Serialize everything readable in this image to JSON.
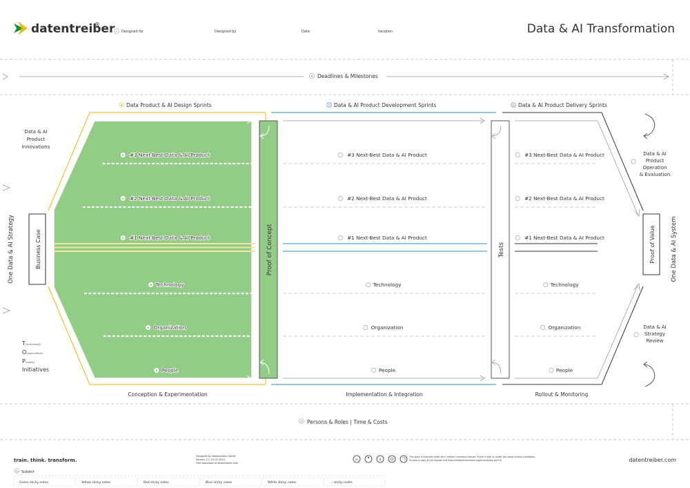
{
  "header": {
    "brand": "datentreiber",
    "brand_mark": "®",
    "title": "Data & AI Transformation",
    "fields": [
      {
        "num": "1",
        "label": "Designed for"
      },
      {
        "num": "",
        "label": "Designed by"
      },
      {
        "num": "",
        "label": "Date"
      },
      {
        "num": "",
        "label": "Iteration"
      }
    ]
  },
  "top_band": {
    "num": "2",
    "label": "Deadlines & Milestones"
  },
  "phases": [
    {
      "num": "4",
      "label": "Data Product & AI Design Sprints",
      "bottom": "Conception & Experimentation",
      "color": "#e8b400"
    },
    {
      "num": "7",
      "label": "Data & AI Product Development Sprints",
      "bottom": "Implementation & Integration",
      "color": "#1f8ec4"
    },
    {
      "num": "9",
      "label": "Data & AI Product Delivery Sprints",
      "bottom": "Rollout & Monitoring",
      "color": "#333333"
    }
  ],
  "left_side": {
    "innovations": [
      "Data & AI",
      "Product",
      "Innovations"
    ],
    "strategy": "One Data & AI Strategy",
    "business_case": "Business Case",
    "tdp": [
      {
        "cap": "T",
        "small": "(echnology)"
      },
      {
        "cap": "O",
        "small": "(rganization)"
      },
      {
        "cap": "P",
        "small": "(eople)"
      }
    ],
    "initiatives": "Initiatives"
  },
  "right_side": {
    "operation": [
      "Data & AI",
      "Product",
      "Operation",
      "& Evaluation"
    ],
    "review": [
      "Data & AI",
      "Strategy",
      "Review"
    ],
    "system": "One Data & AI System",
    "proof_of_value": "Proof of Value"
  },
  "columns": {
    "proof_of_concept": "Proof of Concept",
    "tests": "Tests"
  },
  "rows": [
    {
      "label": "#3 Next-Best Data & AI Product",
      "nums": [
        "5",
        "",
        ""
      ]
    },
    {
      "label": "#2 Next-Best Data & AI Product",
      "nums": [
        "5",
        "",
        ""
      ]
    },
    {
      "label": "#1 Next-Best Data & AI Product",
      "nums": [
        "5",
        "",
        ""
      ]
    },
    {
      "label": "Technology",
      "nums": [
        "6",
        "",
        ""
      ]
    },
    {
      "label": "Organization",
      "nums": [
        "6",
        "",
        ""
      ]
    },
    {
      "label": "People",
      "nums": [
        "6",
        "",
        ""
      ]
    }
  ],
  "bottom_band": {
    "num": "11",
    "label": "Persons & Roles | Time & Costs"
  },
  "footer": {
    "slogan": "train. think. transform.",
    "credits": [
      "Designed by Datentreiber GmbH",
      "Version 1.0, 01.01.2024",
      "Free download at datentreiber.com"
    ],
    "license_lines": [
      "This work is licensed under the Creative Commons license. Share it with us under the same license conditions.",
      "To view a copy of the license visit http://creativecommons.org/licenses/by-sa/4.0/"
    ],
    "website": "datentreiber.com",
    "subject_num": "12",
    "subject_label": "Subject",
    "legend": [
      "Green sticky notes",
      "Yellow sticky notes",
      "Red sticky notes",
      "Blue sticky notes",
      "White sticky notes",
      "... sticky notes"
    ]
  },
  "colors": {
    "green_fill": "#92cc86",
    "yellow": "#e8b400",
    "blue": "#1f8ec4",
    "dark": "#333333"
  }
}
